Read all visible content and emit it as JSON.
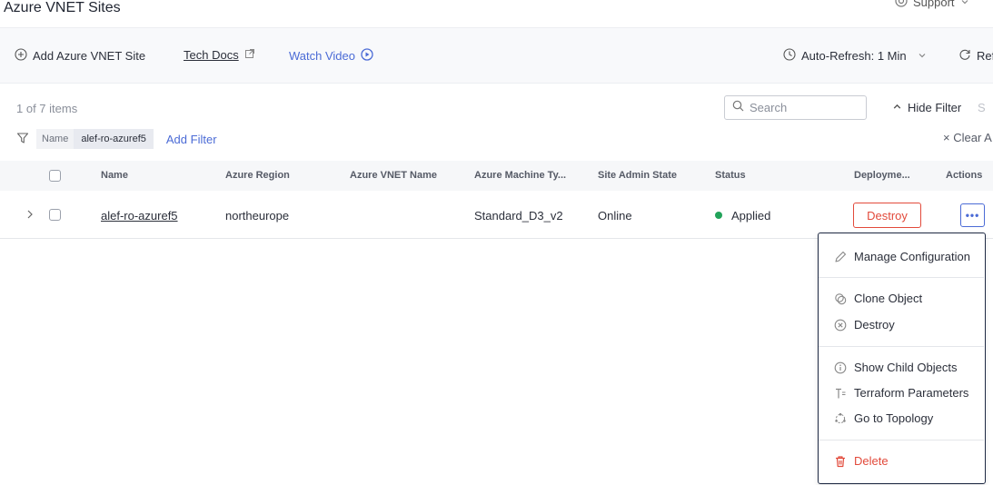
{
  "header": {
    "title": "Azure VNET Sites",
    "support_label": "Support"
  },
  "toolbar": {
    "add_label": "Add Azure VNET Site",
    "docs_label": "Tech Docs",
    "video_label": "Watch Video",
    "auto_refresh_label": "Auto-Refresh: 1 Min",
    "refresh_label": "Ref"
  },
  "filter": {
    "count_text": "1 of 7 items",
    "search_placeholder": "Search",
    "hide_filter_label": "Hide Filter",
    "chip_key": "Name",
    "chip_value": "alef-ro-azuref5",
    "add_filter_label": "Add Filter",
    "clear_all_label": "Clear A"
  },
  "table": {
    "columns": [
      "Name",
      "Azure Region",
      "Azure VNET Name",
      "Azure Machine Ty...",
      "Site Admin State",
      "Status",
      "Deployme...",
      "Actions"
    ],
    "rows": [
      {
        "name": "alef-ro-azuref5",
        "region": "northeurope",
        "vnet_name": "",
        "machine_type": "Standard_D3_v2",
        "admin_state": "Online",
        "status": "Applied",
        "deployment_action": "Destroy",
        "actions_label": "•••"
      }
    ]
  },
  "menu": {
    "items": [
      {
        "label": "Manage Configuration",
        "icon": "pencil-icon"
      },
      {
        "label": "Clone Object",
        "icon": "clone-icon"
      },
      {
        "label": "Destroy",
        "icon": "circle-x-icon"
      },
      {
        "label": "Show Child Objects",
        "icon": "info-icon"
      },
      {
        "label": "Terraform Parameters",
        "icon": "terraform-icon"
      },
      {
        "label": "Go to Topology",
        "icon": "topology-icon"
      },
      {
        "label": "Delete",
        "icon": "trash-icon"
      }
    ]
  },
  "colors": {
    "accent": "#4b6bd6",
    "danger": "#e24a3b",
    "success": "#22a35a"
  }
}
